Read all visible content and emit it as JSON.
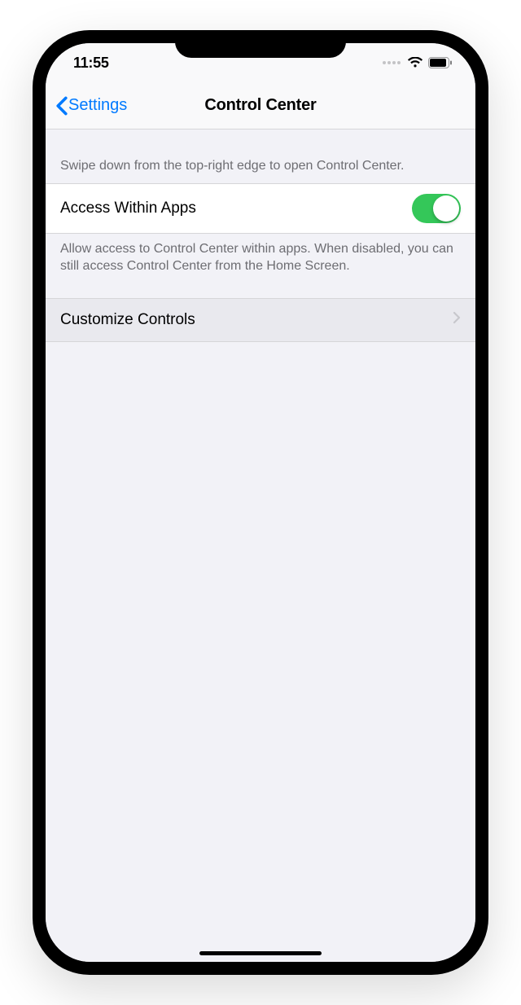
{
  "statusbar": {
    "time": "11:55"
  },
  "nav": {
    "back_label": "Settings",
    "title": "Control Center"
  },
  "section1": {
    "description": "Swipe down from the top-right edge to open Control Center."
  },
  "access": {
    "label": "Access Within Apps",
    "enabled": true,
    "footer": "Allow access to Control Center within apps. When disabled, you can still access Control Center from the Home Screen."
  },
  "customize": {
    "label": "Customize Controls"
  },
  "colors": {
    "tint": "#007aff",
    "toggle_on": "#34c759"
  }
}
